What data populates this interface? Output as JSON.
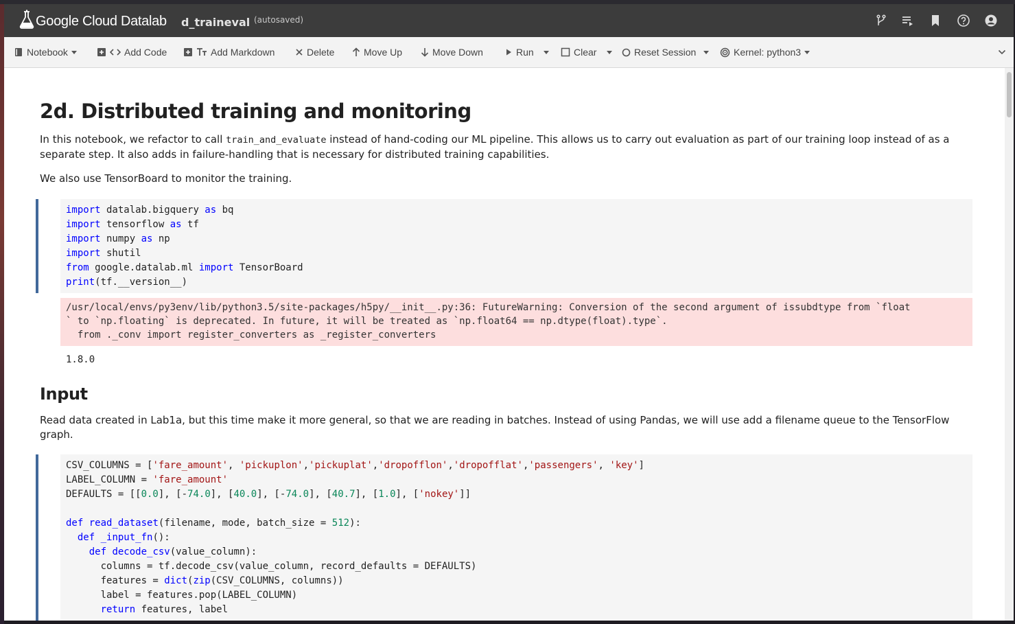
{
  "topbar": {
    "brand": "Google Cloud Datalab",
    "notebook_name": "d_traineval",
    "save_status": "(autosaved)"
  },
  "toolbar": {
    "notebook": "Notebook",
    "add_code": "Add Code",
    "add_markdown": "Add Markdown",
    "delete": "Delete",
    "move_up": "Move Up",
    "move_down": "Move Down",
    "run": "Run",
    "clear": "Clear",
    "reset_session": "Reset Session",
    "kernel": "Kernel: python3"
  },
  "cells": {
    "title": "2d. Distributed training and monitoring",
    "intro_pre": "In this notebook, we refactor to call ",
    "intro_code": "train_and_evaluate",
    "intro_post": " instead of hand-coding our ML pipeline. This allows us to carry out evaluation as part of our training loop instead of as a separate step. It also adds in failure-handling that is necessary for distributed training capabilities.",
    "tensorboard_note": "We also use TensorBoard to monitor the training.",
    "warning_output": "/usr/local/envs/py3env/lib/python3.5/site-packages/h5py/__init__.py:36: FutureWarning: Conversion of the second argument of issubdtype from `float\n` to `np.floating` is deprecated. In future, it will be treated as `np.float64 == np.dtype(float).type`.\n  from ._conv import register_converters as _register_converters",
    "version_output": "1.8.0",
    "input_heading": "Input",
    "input_text": "Read data created in Lab1a, but this time make it more general, so that we are reading in batches. Instead of using Pandas, we will use add a filename queue to the TensorFlow graph."
  },
  "code_cell_1_lines": [
    "import datalab.bigquery as bq",
    "import tensorflow as tf",
    "import numpy as np",
    "import shutil",
    "from google.datalab.ml import TensorBoard",
    "print(tf.__version__)"
  ],
  "code_cell_2_lines": [
    "CSV_COLUMNS = ['fare_amount', 'pickuplon','pickuplat','dropofflon','dropofflat','passengers', 'key']",
    "LABEL_COLUMN = 'fare_amount'",
    "DEFAULTS = [[0.0], [-74.0], [40.0], [-74.0], [40.7], [1.0], ['nokey']]",
    "",
    "def read_dataset(filename, mode, batch_size = 512):",
    "  def _input_fn():",
    "    def decode_csv(value_column):",
    "      columns = tf.decode_csv(value_column, record_defaults = DEFAULTS)",
    "      features = dict(zip(CSV_COLUMNS, columns))",
    "      label = features.pop(LABEL_COLUMN)",
    "      return features, label"
  ]
}
